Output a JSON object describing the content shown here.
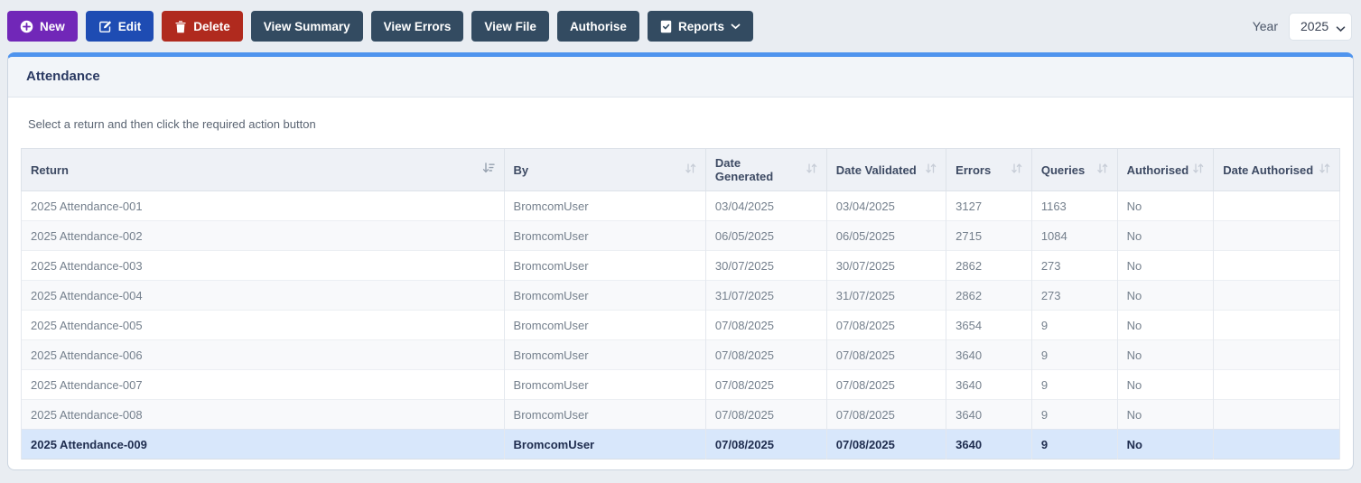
{
  "toolbar": {
    "new_label": "New",
    "edit_label": "Edit",
    "delete_label": "Delete",
    "view_summary_label": "View Summary",
    "view_errors_label": "View Errors",
    "view_file_label": "View File",
    "authorise_label": "Authorise",
    "reports_label": "Reports",
    "year_label": "Year",
    "year_value": "2025"
  },
  "panel": {
    "title": "Attendance",
    "instruction": "Select a return and then click the required action button"
  },
  "table": {
    "columns": [
      {
        "key": "return",
        "label": "Return",
        "sorted": true
      },
      {
        "key": "by",
        "label": "By",
        "sorted": false
      },
      {
        "key": "date_generated",
        "label": "Date Generated",
        "sorted": false
      },
      {
        "key": "date_validated",
        "label": "Date Validated",
        "sorted": false
      },
      {
        "key": "errors",
        "label": "Errors",
        "sorted": false
      },
      {
        "key": "queries",
        "label": "Queries",
        "sorted": false
      },
      {
        "key": "authorised",
        "label": "Authorised",
        "sorted": false
      },
      {
        "key": "date_authorised",
        "label": "Date Authorised",
        "sorted": false
      }
    ],
    "rows": [
      {
        "return": "2025 Attendance-001",
        "by": "BromcomUser",
        "date_generated": "03/04/2025",
        "date_validated": "03/04/2025",
        "errors": "3127",
        "queries": "1163",
        "authorised": "No",
        "date_authorised": ""
      },
      {
        "return": "2025 Attendance-002",
        "by": "BromcomUser",
        "date_generated": "06/05/2025",
        "date_validated": "06/05/2025",
        "errors": "2715",
        "queries": "1084",
        "authorised": "No",
        "date_authorised": ""
      },
      {
        "return": "2025 Attendance-003",
        "by": "BromcomUser",
        "date_generated": "30/07/2025",
        "date_validated": "30/07/2025",
        "errors": "2862",
        "queries": "273",
        "authorised": "No",
        "date_authorised": ""
      },
      {
        "return": "2025 Attendance-004",
        "by": "BromcomUser",
        "date_generated": "31/07/2025",
        "date_validated": "31/07/2025",
        "errors": "2862",
        "queries": "273",
        "authorised": "No",
        "date_authorised": ""
      },
      {
        "return": "2025 Attendance-005",
        "by": "BromcomUser",
        "date_generated": "07/08/2025",
        "date_validated": "07/08/2025",
        "errors": "3654",
        "queries": "9",
        "authorised": "No",
        "date_authorised": ""
      },
      {
        "return": "2025 Attendance-006",
        "by": "BromcomUser",
        "date_generated": "07/08/2025",
        "date_validated": "07/08/2025",
        "errors": "3640",
        "queries": "9",
        "authorised": "No",
        "date_authorised": ""
      },
      {
        "return": "2025 Attendance-007",
        "by": "BromcomUser",
        "date_generated": "07/08/2025",
        "date_validated": "07/08/2025",
        "errors": "3640",
        "queries": "9",
        "authorised": "No",
        "date_authorised": ""
      },
      {
        "return": "2025 Attendance-008",
        "by": "BromcomUser",
        "date_generated": "07/08/2025",
        "date_validated": "07/08/2025",
        "errors": "3640",
        "queries": "9",
        "authorised": "No",
        "date_authorised": ""
      },
      {
        "return": "2025 Attendance-009",
        "by": "BromcomUser",
        "date_generated": "07/08/2025",
        "date_validated": "07/08/2025",
        "errors": "3640",
        "queries": "9",
        "authorised": "No",
        "date_authorised": ""
      }
    ],
    "selected_row_index": 8
  },
  "colors": {
    "accent_blue": "#4f94ee",
    "new_purple": "#7127b8",
    "edit_blue": "#1e4cb3",
    "delete_red": "#b02a1e",
    "dark_slate": "#334b61",
    "selected_row_bg": "#d8e7fb",
    "page_bg": "#e9edf2"
  }
}
